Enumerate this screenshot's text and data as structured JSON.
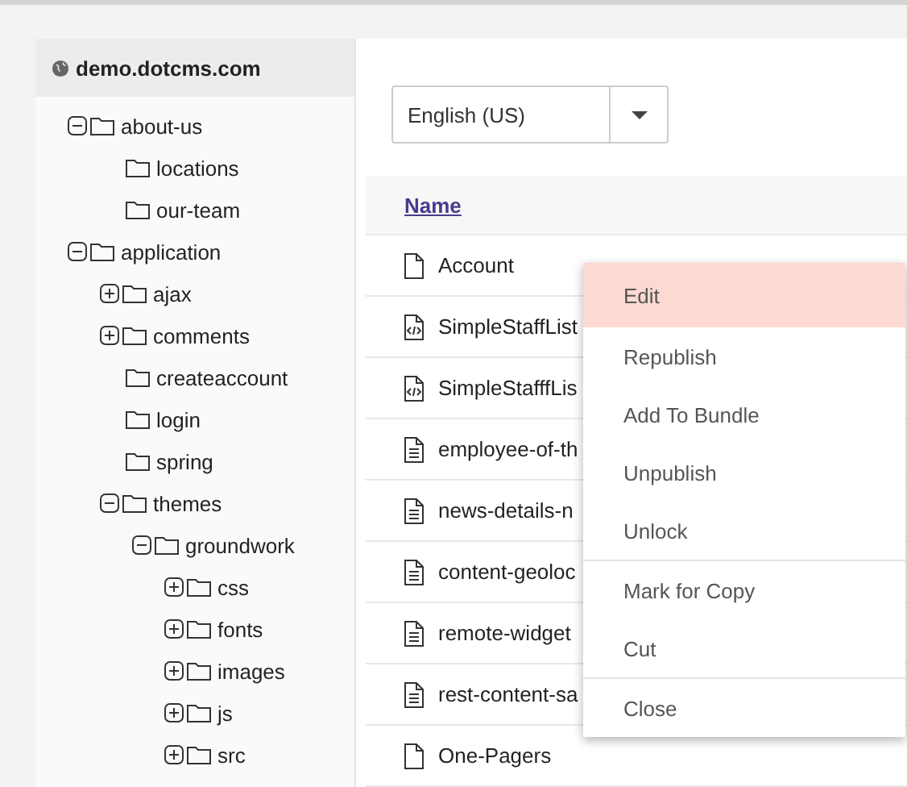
{
  "site": {
    "title": "demo.dotcms.com"
  },
  "tree": [
    {
      "label": "about-us",
      "expanded": true,
      "children": [
        {
          "label": "locations"
        },
        {
          "label": "our-team"
        }
      ]
    },
    {
      "label": "application",
      "expanded": true,
      "children": [
        {
          "label": "ajax",
          "expanded": false
        },
        {
          "label": "comments",
          "expanded": false
        },
        {
          "label": "createaccount"
        },
        {
          "label": "login"
        },
        {
          "label": "spring"
        },
        {
          "label": "themes",
          "expanded": true,
          "children": [
            {
              "label": "groundwork",
              "expanded": true,
              "children": [
                {
                  "label": "css",
                  "expanded": false
                },
                {
                  "label": "fonts",
                  "expanded": false
                },
                {
                  "label": "images",
                  "expanded": false
                },
                {
                  "label": "js",
                  "expanded": false
                },
                {
                  "label": "src",
                  "expanded": false
                }
              ]
            }
          ]
        }
      ]
    }
  ],
  "language": {
    "value": "English (US)"
  },
  "table": {
    "columns": [
      "Name"
    ],
    "rows": [
      {
        "kind": "page",
        "name": "Account"
      },
      {
        "kind": "widget",
        "name": "SimpleStaffList"
      },
      {
        "kind": "widget",
        "name": "SimpleStafffLis"
      },
      {
        "kind": "content",
        "name": "employee-of-th"
      },
      {
        "kind": "content",
        "name": "news-details-n"
      },
      {
        "kind": "content",
        "name": "content-geoloc"
      },
      {
        "kind": "content",
        "name": "remote-widget"
      },
      {
        "kind": "content",
        "name": "rest-content-sa"
      },
      {
        "kind": "page",
        "name": "One-Pagers"
      }
    ]
  },
  "context_menu": {
    "groups": [
      [
        {
          "label": "Edit",
          "selected": true
        },
        {
          "label": "Republish",
          "selected": false
        },
        {
          "label": "Add To Bundle",
          "selected": false
        },
        {
          "label": "Unpublish",
          "selected": false
        },
        {
          "label": "Unlock",
          "selected": false
        }
      ],
      [
        {
          "label": "Mark for Copy",
          "selected": false
        },
        {
          "label": "Cut",
          "selected": false
        }
      ],
      [
        {
          "label": "Close",
          "selected": false
        }
      ]
    ]
  }
}
